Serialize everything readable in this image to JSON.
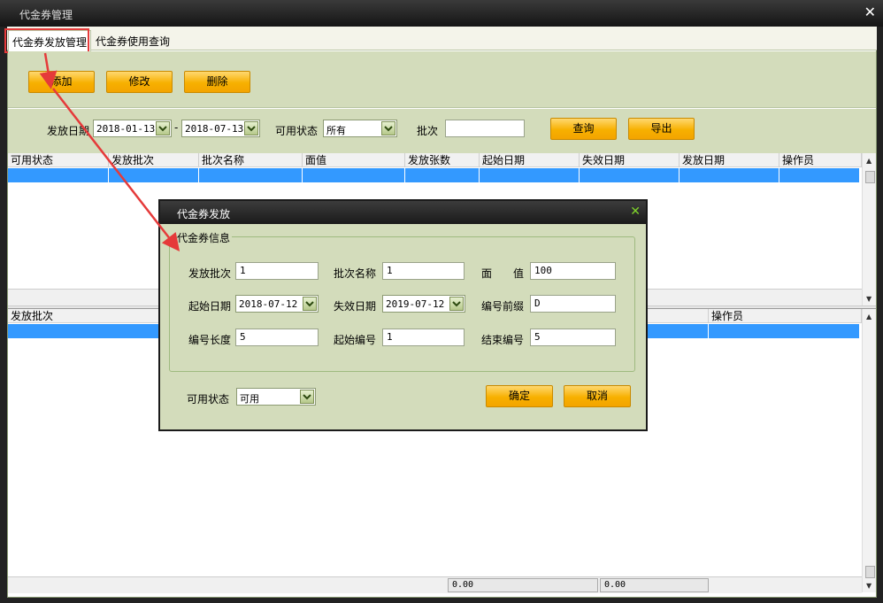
{
  "window": {
    "title": "代金券管理"
  },
  "tabs": [
    {
      "label": "代金券发放管理",
      "active": true
    },
    {
      "label": "代金券使用查询",
      "active": false
    }
  ],
  "toolbar": {
    "add": "添加",
    "edit": "修改",
    "delete": "删除"
  },
  "filter": {
    "date_label": "发放日期",
    "date_from": "2018-01-13",
    "date_sep": "-",
    "date_to": "2018-07-13",
    "status_label": "可用状态",
    "status_value": "所有",
    "batch_label": "批次",
    "batch_value": "",
    "query_button": "查询",
    "export_button": "导出"
  },
  "top_table": {
    "columns": [
      "可用状态",
      "发放批次",
      "批次名称",
      "面值",
      "发放张数",
      "起始日期",
      "失效日期",
      "发放日期",
      "操作员"
    ]
  },
  "bottom_table": {
    "columns": [
      "发放批次",
      "操作员"
    ]
  },
  "footer": {
    "total1": "0.00",
    "total2": "0.00"
  },
  "dialog": {
    "title": "代金券发放",
    "group_title": "代金券信息",
    "fields": {
      "batch_label": "发放批次",
      "batch_value": "1",
      "name_label": "批次名称",
      "name_value": "1",
      "face_label": "面　　值",
      "face_value": "100",
      "start_label": "起始日期",
      "start_value": "2018-07-12",
      "expire_label": "失效日期",
      "expire_value": "2019-07-12",
      "prefix_label": "编号前缀",
      "prefix_value": "D",
      "len_label": "编号长度",
      "len_value": "5",
      "startno_label": "起始编号",
      "startno_value": "1",
      "endno_label": "结束编号",
      "endno_value": "5"
    },
    "status_label": "可用状态",
    "status_value": "可用",
    "ok_button": "确定",
    "cancel_button": "取消"
  },
  "colors": {
    "accent_orange": "#f7b000",
    "panel_green": "#d3dcbb",
    "selection_blue": "#3399ff",
    "annotation_red": "#e53a3a"
  },
  "icons": {
    "close": "close-icon",
    "dropdown": "chevron-down-icon",
    "scroll_up": "scroll-up-icon",
    "scroll_down": "scroll-down-icon"
  }
}
